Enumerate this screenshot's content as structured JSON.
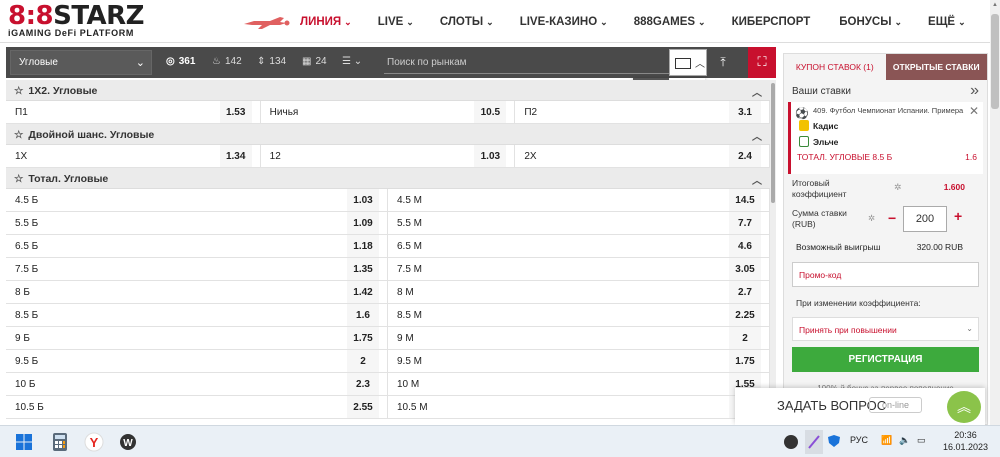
{
  "logo": {
    "main_a": "8:8",
    "main_b": "STARZ",
    "sub": "iGAMING DeFi PLATFORM"
  },
  "nav": [
    {
      "label": "ЛИНИЯ",
      "chev": "⌄"
    },
    {
      "label": "LIVE",
      "chev": "⌄"
    },
    {
      "label": "СЛОТЫ",
      "chev": "⌄"
    },
    {
      "label": "LIVE-КАЗИНО",
      "chev": "⌄"
    },
    {
      "label": "888GAMES",
      "chev": "⌄"
    },
    {
      "label": "КИБЕРСПОРТ",
      "chev": ""
    },
    {
      "label": "БОНУСЫ",
      "chev": "⌄"
    },
    {
      "label": "ЕЩЁ",
      "chev": "⌄"
    }
  ],
  "filter": {
    "dropdown": "Угловые",
    "counts": [
      "361",
      "142",
      "134",
      "24"
    ],
    "search_placeholder": "Поиск по рынкам"
  },
  "markets": [
    {
      "title": "1Х2. Угловые",
      "type": "three",
      "rows": [
        [
          [
            "П1",
            "1.53"
          ],
          [
            "Ничья",
            "10.5"
          ],
          [
            "П2",
            "3.1"
          ]
        ]
      ]
    },
    {
      "title": "Двойной шанс. Угловые",
      "type": "three",
      "rows": [
        [
          [
            "1Х",
            "1.34"
          ],
          [
            "12",
            "1.03"
          ],
          [
            "2Х",
            "2.4"
          ]
        ]
      ]
    },
    {
      "title": "Тотал. Угловые",
      "type": "two",
      "rows": [
        [
          [
            "4.5 Б",
            "1.03"
          ],
          [
            "4.5 М",
            "14.5"
          ]
        ],
        [
          [
            "5.5 Б",
            "1.09"
          ],
          [
            "5.5 М",
            "7.7"
          ]
        ],
        [
          [
            "6.5 Б",
            "1.18"
          ],
          [
            "6.5 М",
            "4.6"
          ]
        ],
        [
          [
            "7.5 Б",
            "1.35"
          ],
          [
            "7.5 М",
            "3.05"
          ]
        ],
        [
          [
            "8 Б",
            "1.42"
          ],
          [
            "8 М",
            "2.7"
          ]
        ],
        [
          [
            "8.5 Б",
            "1.6"
          ],
          [
            "8.5 М",
            "2.25"
          ]
        ],
        [
          [
            "9 Б",
            "1.75"
          ],
          [
            "9 М",
            "2"
          ]
        ],
        [
          [
            "9.5 Б",
            "2"
          ],
          [
            "9.5 М",
            "1.75"
          ]
        ],
        [
          [
            "10 Б",
            "2.3"
          ],
          [
            "10 М",
            "1.55"
          ]
        ],
        [
          [
            "10.5 Б",
            "2.55"
          ],
          [
            "10.5 М",
            ""
          ]
        ]
      ]
    }
  ],
  "coupon": {
    "tab1": "КУПОН СТАВОК (1)",
    "tab2": "ОТКРЫТЫЕ СТАВКИ",
    "your_bets": "Ваши ставки",
    "league": "409. Футбол Чемпионат Испании. Примера",
    "team1": "Кадис",
    "team2": "Эльче",
    "bet": "ТОТАЛ. УГЛОВЫЕ 8.5 Б",
    "bet_odd": "1.6",
    "total_label": "Итоговый коэффициент",
    "total_value": "1.600",
    "stake_label": "Сумма ставки (RUB)",
    "stake_value": "200",
    "win_label": "Возможный выигрыш",
    "win_value": "320.00 RUB",
    "promo_placeholder": "Промо-код",
    "on_change": "При изменении коэффициента:",
    "accept": "Принять при повышении",
    "register": "РЕГИСТРАЦИЯ",
    "bonus": "100%-й бонус за первое пополнение"
  },
  "ask": {
    "label": "ЗАДАТЬ ВОПРОС",
    "status": "on-line"
  },
  "taskbar": {
    "lang": "РУС",
    "time": "20:36",
    "date": "16.01.2023"
  },
  "colors": {
    "brand_red": "#c8102e",
    "green": "#3daa3d"
  }
}
